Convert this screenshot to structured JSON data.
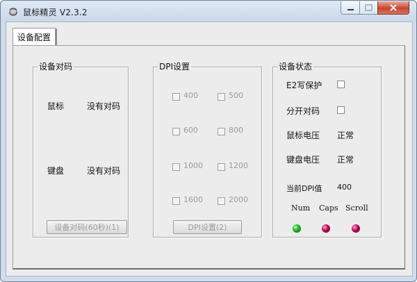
{
  "window": {
    "title": "鼠标精灵 V2.3.2"
  },
  "tabs": [
    {
      "label": "设备配置"
    }
  ],
  "pairing": {
    "title": "设备对码",
    "mouse_label": "鼠标",
    "mouse_status": "没有对码",
    "keyboard_label": "键盘",
    "keyboard_status": "没有对码",
    "button_label": "设备对码(60秒)(1)"
  },
  "dpi": {
    "title": "DPI设置",
    "options": [
      "400",
      "500",
      "600",
      "800",
      "1000",
      "1200",
      "1600",
      "2000"
    ],
    "button_label": "DPI设置(2)"
  },
  "status": {
    "title": "设备状态",
    "e2_label": "E2写保护",
    "split_label": "分开对码",
    "mouse_voltage_label": "鼠标电压",
    "mouse_voltage_value": "正常",
    "keyboard_voltage_label": "键盘电压",
    "keyboard_voltage_value": "正常",
    "current_dpi_label": "当前DPI值",
    "current_dpi_value": "400",
    "indicators": [
      {
        "label": "Num",
        "color": "#21b021",
        "on": true
      },
      {
        "label": "Caps",
        "color": "#a0104a",
        "on": false
      },
      {
        "label": "Scroll",
        "color": "#a0104a",
        "on": false
      }
    ]
  }
}
